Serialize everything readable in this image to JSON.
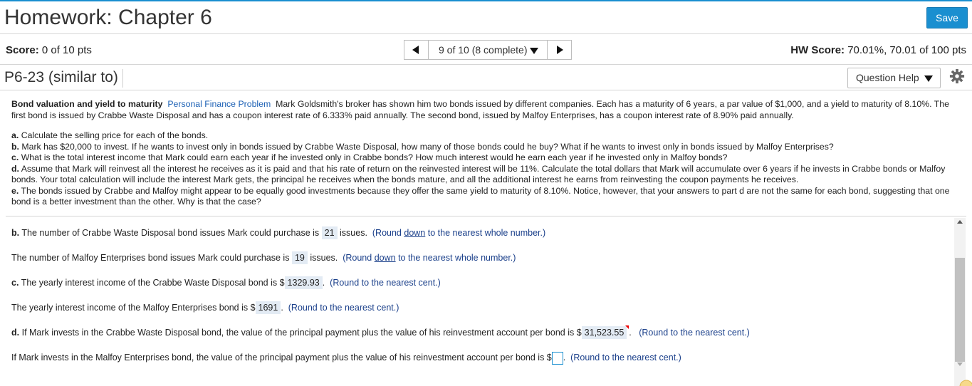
{
  "header": {
    "title": "Homework: Chapter 6",
    "save_label": "Save"
  },
  "scorebar": {
    "score_label": "Score:",
    "score_value": "0 of 10 pts",
    "question_nav": "9 of 10 (8 complete)",
    "hw_label": "HW Score:",
    "hw_value": "70.01%, 70.01 of 100 pts"
  },
  "question": {
    "title": "P6-23 (similar to)",
    "help_label": "Question Help"
  },
  "problem": {
    "heading": "Bond valuation and yield to maturity",
    "tag": "Personal Finance Problem",
    "text": "Mark Goldsmith's broker has shown him two bonds issued by different companies.  Each has a maturity of 6 years, a par value of $1,000, and a yield to maturity of 8.10%.  The first bond is issued by Crabbe Waste Disposal and has a coupon interest rate of 6.333% paid annually.  The second  bond, issued by Malfoy Enterprises, has a coupon interest rate of 8.90% paid annually."
  },
  "parts": [
    {
      "letter": "a.",
      "text": "Calculate the selling price for each of the bonds."
    },
    {
      "letter": "b.",
      "text": "Mark has $20,000 to invest.  If he wants to invest only in bonds issued by Crabbe Waste Disposal, how many of those bonds could he buy? What if he wants to invest only in bonds issued by Malfoy Enterprises?"
    },
    {
      "letter": "c.",
      "text": "What is the total interest income that Mark could earn each year if he invested only in Crabbe bonds? How much interest would he earn each year if he invested only in Malfoy bonds?"
    },
    {
      "letter": "d.",
      "text": "Assume that Mark will reinvest all the interest he receives as it is paid and that his rate of return on the reinvested interest will be 11%. Calculate the total dollars that Mark will accumulate over 6 years if he invests in Crabbe bonds or Malfoy bonds. Your total calculation will include the interest Mark gets, the principal he receives when the bonds mature, and all the additional interest he earns from reinvesting the coupon payments he receives."
    },
    {
      "letter": "e.",
      "text": "The bonds issued by Crabbe and Malfoy might appear to be equally good investments because they offer the same yield to maturity of 8.10%. Notice, however, that your answers to part d are not the same for each bond, suggesting that one bond is a better investment than the other. Why is that the case?"
    }
  ],
  "answers": {
    "b1": {
      "letter": "b.",
      "pre": "The number of Crabbe Waste Disposal bond issues Mark could purchase is",
      "value": "21",
      "post": "issues.",
      "hint_pre": "(Round",
      "hint_u": "down",
      "hint_post": "to the nearest whole number.)"
    },
    "b2": {
      "pre": "The number of Malfoy Enterprises bond issues Mark could purchase is",
      "value": "19",
      "post": "issues.",
      "hint_pre": "(Round",
      "hint_u": "down",
      "hint_post": "to the nearest whole number.)"
    },
    "c1": {
      "letter": "c.",
      "pre": "The yearly interest income of the Crabbe Waste Disposal bond is $",
      "value": "1329.93",
      "hint": "(Round to the nearest cent.)"
    },
    "c2": {
      "pre": "The yearly interest income of the Malfoy Enterprises bond is $",
      "value": "1691",
      "hint": "(Round to the nearest cent.)"
    },
    "d1": {
      "letter": "d.",
      "pre": "If Mark invests in the Crabbe Waste Disposal bond, the value of the principal payment plus the value of his reinvestment account per bond is $",
      "value": "31,523.55",
      "hint": "(Round to the nearest cent.)"
    },
    "d2": {
      "pre": "If Mark invests in the Malfoy Enterprises bond, the value of the principal payment plus the value of his reinvestment account per bond is $",
      "value": "",
      "hint": "(Round to the nearest cent.)"
    }
  },
  "colors": {
    "accent": "#1a8fd0",
    "hint": "#1a3f8a",
    "answer_bg": "#e3ebf4"
  }
}
